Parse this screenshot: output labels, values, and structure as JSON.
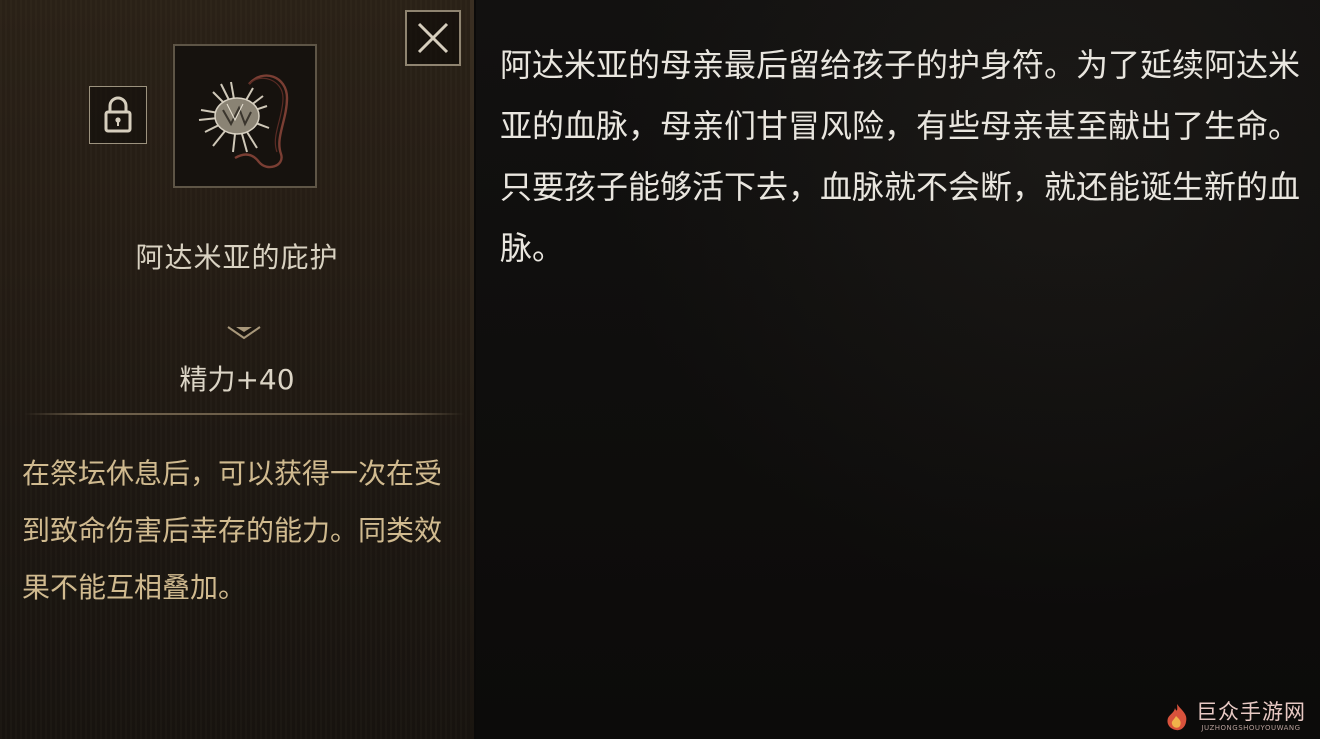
{
  "item": {
    "name": "阿达米亚的庇护",
    "stat": "精力+40",
    "effect": "在祭坛休息后，可以获得一次在受到致命伤害后幸存的能力。同类效果不能互相叠加。",
    "icon": "amulet-icon"
  },
  "controls": {
    "close_icon": "close-icon",
    "lock_icon": "lock-icon"
  },
  "lore": {
    "text": "阿达米亚的母亲最后留给孩子的护身符。为了延续阿达米亚的血脉，母亲们甘冒风险，有些母亲甚至献出了生命。只要孩子能够活下去，血脉就不会断，就还能诞生新的血脉。"
  },
  "watermark": {
    "name": "巨众手游网",
    "sub": "JUZHONGSHOUYOUWANG"
  },
  "colors": {
    "effect_text": "#d0ba8f",
    "lore_text": "#e9e6df",
    "frame_border": "#8f8470"
  }
}
